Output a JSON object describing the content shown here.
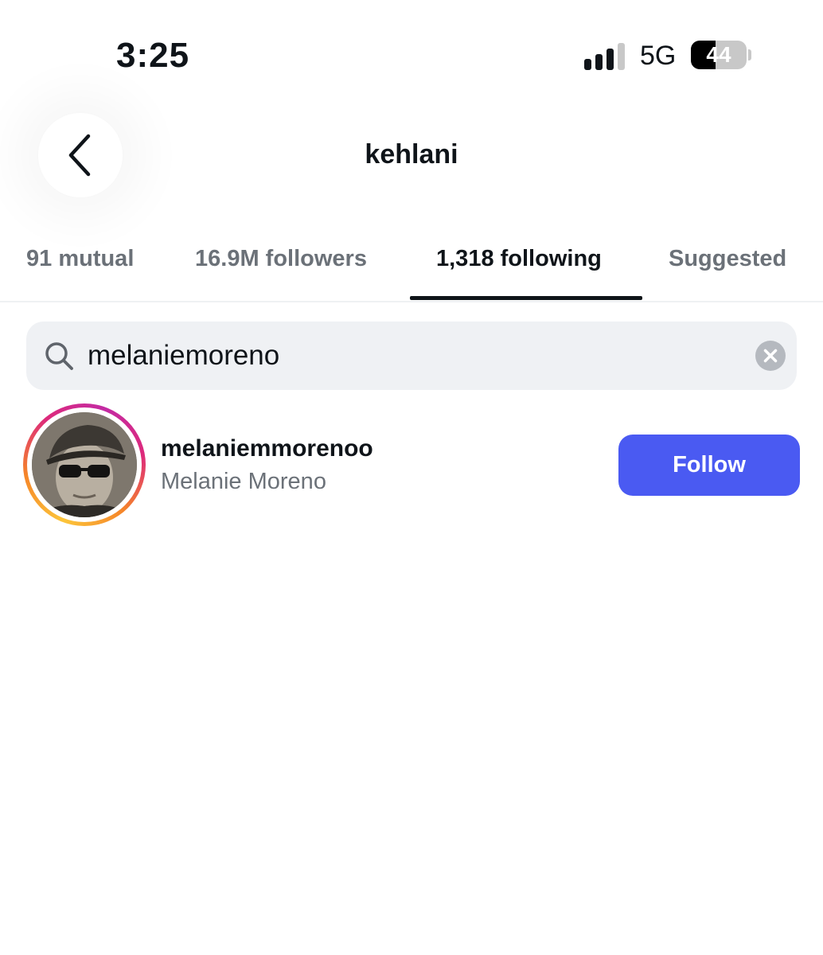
{
  "status_bar": {
    "time": "3:25",
    "network": "5G",
    "battery_level": "44",
    "battery_fraction": 0.44,
    "signal_bars_active": 3,
    "signal_bars_total": 4
  },
  "header": {
    "title": "kehlani",
    "back_icon": "chevron-left-icon"
  },
  "tabs": [
    {
      "label": "91 mutual",
      "active": false
    },
    {
      "label": "16.9M followers",
      "active": false
    },
    {
      "label": "1,318 following",
      "active": true
    },
    {
      "label": "Suggested",
      "active": false
    }
  ],
  "search": {
    "value": "melaniemoreno",
    "icon": "search-icon",
    "clear_icon": "clear-icon"
  },
  "results": [
    {
      "username": "melaniemmorenoo",
      "display_name": "Melanie Moreno",
      "follow_label": "Follow"
    }
  ],
  "colors": {
    "accent": "#4a5af2",
    "text_primary": "#0f1419",
    "text_secondary": "#6b7178",
    "search_bg": "#eff1f4"
  }
}
